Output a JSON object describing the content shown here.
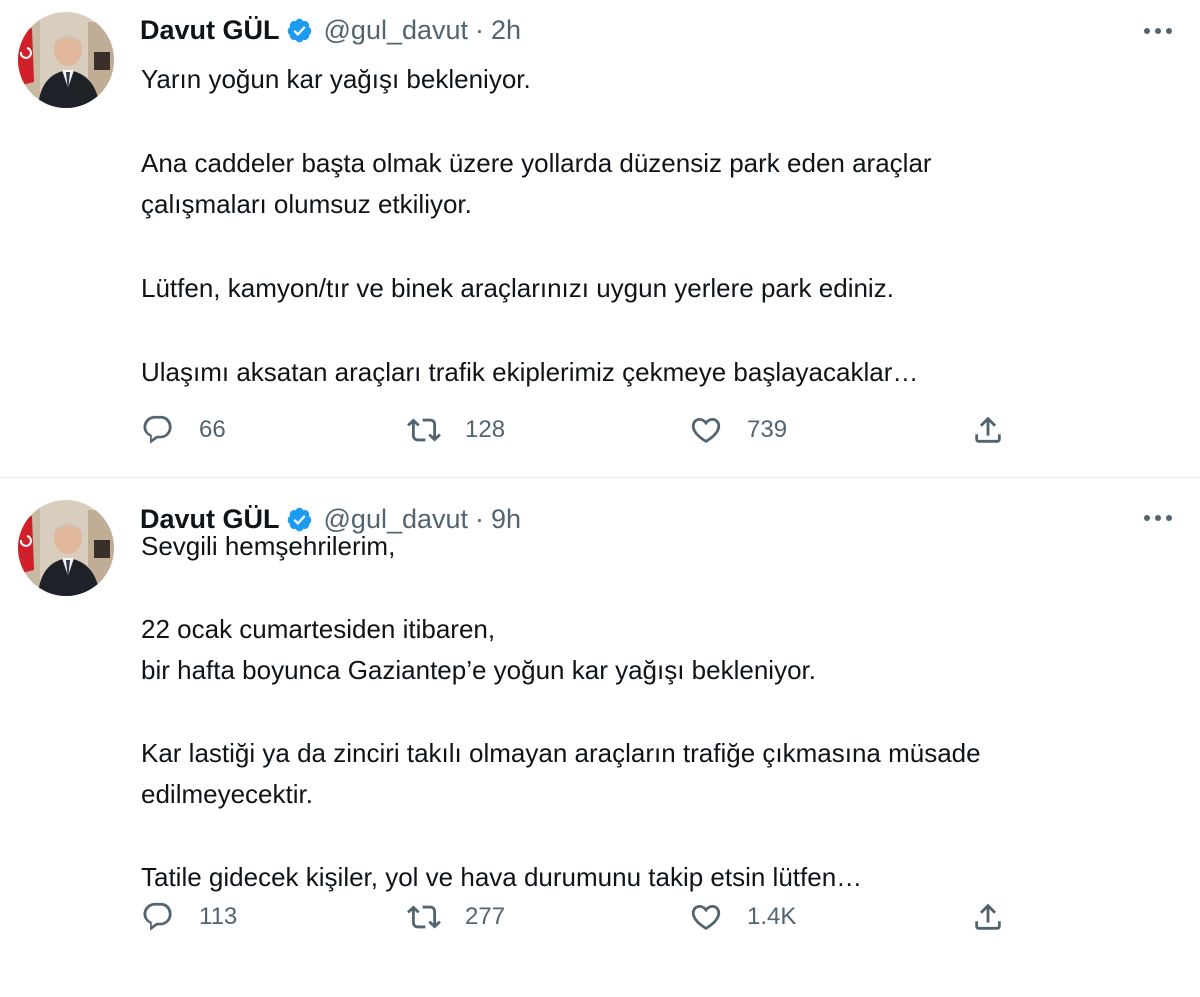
{
  "colors": {
    "text": "#0f1419",
    "secondary": "#536471",
    "verified": "#1d9bf0",
    "divider": "#e6ecf0"
  },
  "icons": {
    "reply": "reply-icon",
    "retweet": "retweet-icon",
    "like": "heart-icon",
    "share": "share-icon",
    "more": "more-icon",
    "verified": "verified-badge-icon"
  },
  "tweets": [
    {
      "name": "Davut GÜL",
      "handle": "@gul_davut",
      "separator": "·",
      "time": "2h",
      "paragraphs": [
        [
          "Yarın yoğun kar yağışı bekleniyor."
        ],
        [
          "Ana caddeler başta olmak üzere yollarda düzensiz park eden araçlar",
          "çalışmaları olumsuz etkiliyor."
        ],
        [
          "Lütfen, kamyon/tır ve binek araçlarınızı uygun yerlere park ediniz."
        ],
        [
          "Ulaşımı aksatan araçları trafik ekiplerimiz çekmeye başlayacaklar…"
        ]
      ],
      "replies": "66",
      "retweets": "128",
      "likes": "739"
    },
    {
      "name": "Davut GÜL",
      "handle": "@gul_davut",
      "separator": "·",
      "time": "9h",
      "paragraphs": [
        [
          "Sevgili hemşehrilerim,"
        ],
        [
          "22 ocak cumartesiden itibaren,",
          "bir hafta boyunca Gaziantep’e yoğun kar yağışı bekleniyor."
        ],
        [
          "Kar lastiği ya da zinciri takılı olmayan araçların trafiğe çıkmasına müsade",
          "edilmeyecektir."
        ],
        [
          "Tatile gidecek kişiler, yol ve hava durumunu takip etsin lütfen…"
        ]
      ],
      "replies": "113",
      "retweets": "277",
      "likes": "1.4K"
    }
  ]
}
